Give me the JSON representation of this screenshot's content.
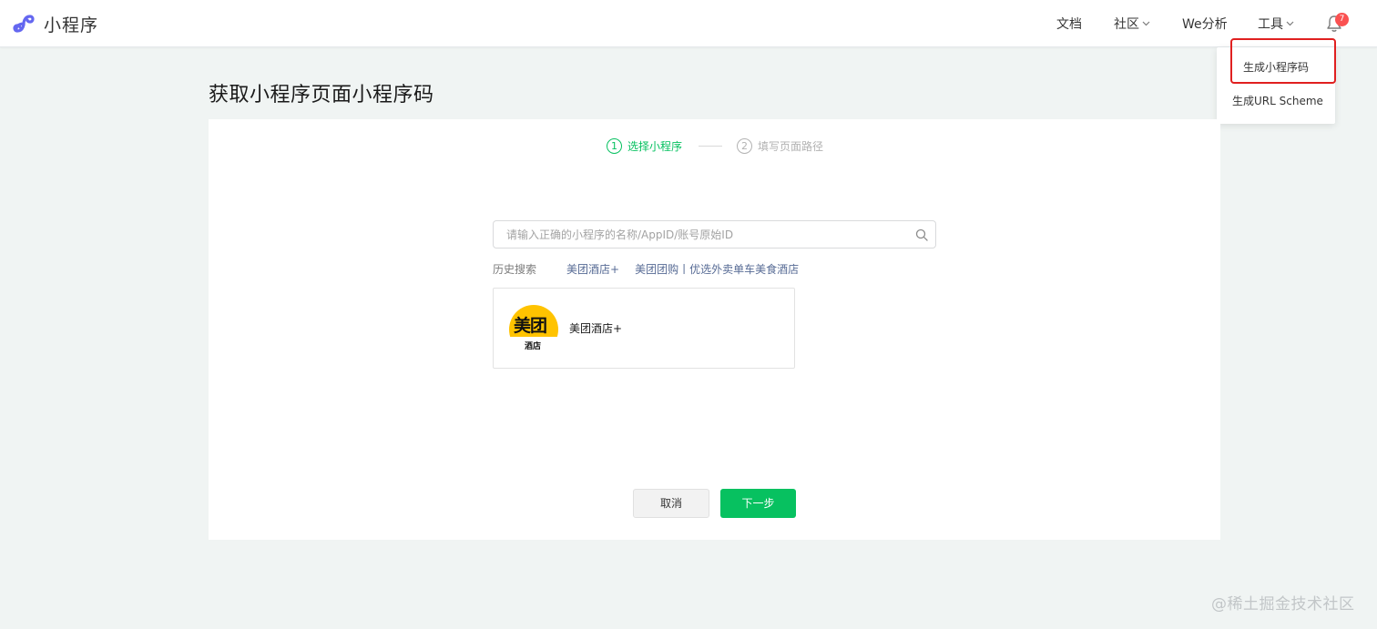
{
  "header": {
    "logo_text": "小程序",
    "nav": {
      "docs": "文档",
      "community": "社区",
      "we_analytics": "We分析",
      "tools": "工具"
    },
    "notification_count": "7"
  },
  "tools_dropdown": {
    "items": [
      {
        "label": "生成小程序码",
        "highlighted": true
      },
      {
        "label": "生成URL Scheme",
        "highlighted": false
      }
    ]
  },
  "page": {
    "title": "获取小程序页面小程序码"
  },
  "steps": [
    {
      "num": "1",
      "label": "选择小程序",
      "state": "active"
    },
    {
      "num": "2",
      "label": "填写页面路径",
      "state": "inactive"
    }
  ],
  "search": {
    "placeholder": "请输入正确的小程序的名称/AppID/账号原始ID",
    "value": ""
  },
  "history": {
    "label": "历史搜索",
    "items": [
      "美团酒店+",
      "美团团购丨优选外卖单车美食酒店"
    ]
  },
  "result": {
    "name": "美团酒店+",
    "logo_text_main": "美团",
    "logo_text_sub": "酒店"
  },
  "buttons": {
    "cancel": "取消",
    "next": "下一步"
  },
  "watermark": "@稀土掘金技术社区",
  "colors": {
    "accent_green": "#07c160",
    "link_blue": "#576b95",
    "badge_red": "#fa5151",
    "highlight_red": "#e02020",
    "logo_yellow": "#ffc300",
    "brand_purple": "#6467f0"
  }
}
